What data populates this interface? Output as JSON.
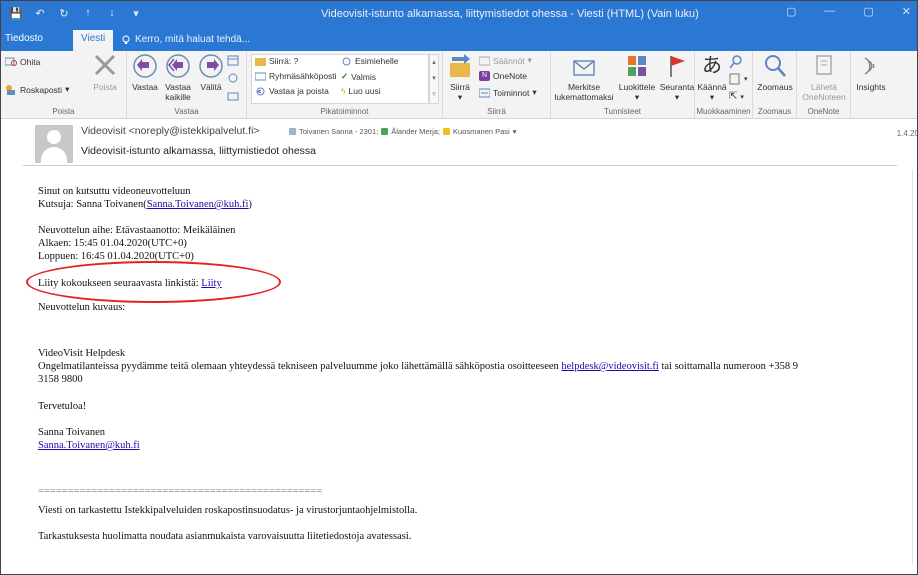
{
  "window": {
    "title": "Videovisit-istunto alkamassa, liittymistiedot ohessa - Viesti (HTML) (Vain luku)",
    "qat": [
      "💾",
      "↶",
      "↻",
      "↑",
      "↓",
      "▾"
    ],
    "controls": [
      "▢",
      "—",
      "▢",
      "✕"
    ]
  },
  "tabs": {
    "file": "Tiedosto",
    "message": "Viesti",
    "tell_me": "Kerro, mitä haluat tehdä..."
  },
  "ribbon": {
    "delete": {
      "ignore": "Ohita",
      "junk": "Roskaposti",
      "delete": "Poista",
      "label": "Poista"
    },
    "respond": {
      "reply": "Vastaa",
      "reply_all_line1": "Vastaa",
      "reply_all_line2": "kaikille",
      "forward": "Välitä",
      "label": "Vastaa"
    },
    "quick_steps": {
      "move_to": "Siirrä: ?",
      "to_manager": "Esimiehelle",
      "team_email": "Ryhmäsähköposti",
      "done": "Valmis",
      "reply_delete": "Vastaa ja poista",
      "create_new": "Luo uusi",
      "label": "Pikatoiminnot"
    },
    "move": {
      "move": "Siirrä",
      "rules": "Säännöt",
      "onenote": "OneNote",
      "actions": "Toiminnot",
      "label": "Siirrä"
    },
    "tags": {
      "mark_unread_line1": "Merkitse",
      "mark_unread_line2": "lukemattomaksi",
      "categorize": "Luokittele",
      "follow_up": "Seuranta",
      "label": "Tunnisteet"
    },
    "editing": {
      "translate": "Käännä",
      "label": "Muokkaaminen"
    },
    "zoom": {
      "zoom": "Zoomaus",
      "label": "Zoomaus"
    },
    "onenote": {
      "send_line1": "Lähetä",
      "send_line2": "OneNoteen",
      "label": "OneNote"
    },
    "insights": {
      "label": "Insights"
    }
  },
  "header": {
    "sender": "Videovisit <noreply@istekkipalvelut.fi>",
    "recipients": [
      {
        "name": "Toivanen Sanna - 2301;",
        "color": "#9fb4c8"
      },
      {
        "name": "Ålander Merja;",
        "color": "#4aa35e"
      },
      {
        "name": "Kuosmanen Pasi",
        "color": "#e8c326"
      }
    ],
    "recipients_more": "▾",
    "subject": "Videovisit-istunto alkamassa, liittymistiedot ohessa",
    "version": "1.4.20"
  },
  "body": {
    "invited": "Sinut on kutsuttu videoneuvotteluun",
    "inviter_prefix": "Kutsuja: Sanna Toivanen(",
    "inviter_email": "Sanna.Toivanen@kuh.fi",
    "inviter_suffix": ")",
    "topic": "Neuvottelun aihe: Etävastaanotto: Meikäläinen",
    "starts": "Alkaen: 15:45 01.04.2020(UTC+0)",
    "ends": "Loppuen: 16:45 01.04.2020(UTC+0)",
    "join_prefix": "Liity kokoukseen seuraavasta linkistä: ",
    "join_link": "Liity",
    "description": "Neuvottelun kuvaus:",
    "helpdesk_title": "VideoVisit Helpdesk",
    "helpdesk_text": "Ongelmatilanteissa pyydämme teitä olemaan yhteydessä tekniseen palveluumme joko lähettämällä sähköpostia osoitteeseen ",
    "helpdesk_email": "helpdesk@videovisit.fi",
    "helpdesk_text2": " tai soittamalla numeroon +358 9",
    "helpdesk_phone_cont": "3158 9800",
    "welcome": "Tervetuloa!",
    "signature_name": "Sanna Toivanen",
    "signature_email": "Sanna.Toivanen@kuh.fi",
    "separator": "================================================",
    "scanned": "Viesti on tarkastettu Istekkipalveluiden roskapostinsuodatus- ja virustorjuntaohjelmistolla.",
    "caution": "Tarkastuksesta huolimatta noudata asianmukaista varovaisuutta liitetiedostoja avatessasi."
  },
  "colors": {
    "titlebar": "#2b78d4",
    "highlight_oval": "#e32323",
    "link": "#1a0dab"
  }
}
